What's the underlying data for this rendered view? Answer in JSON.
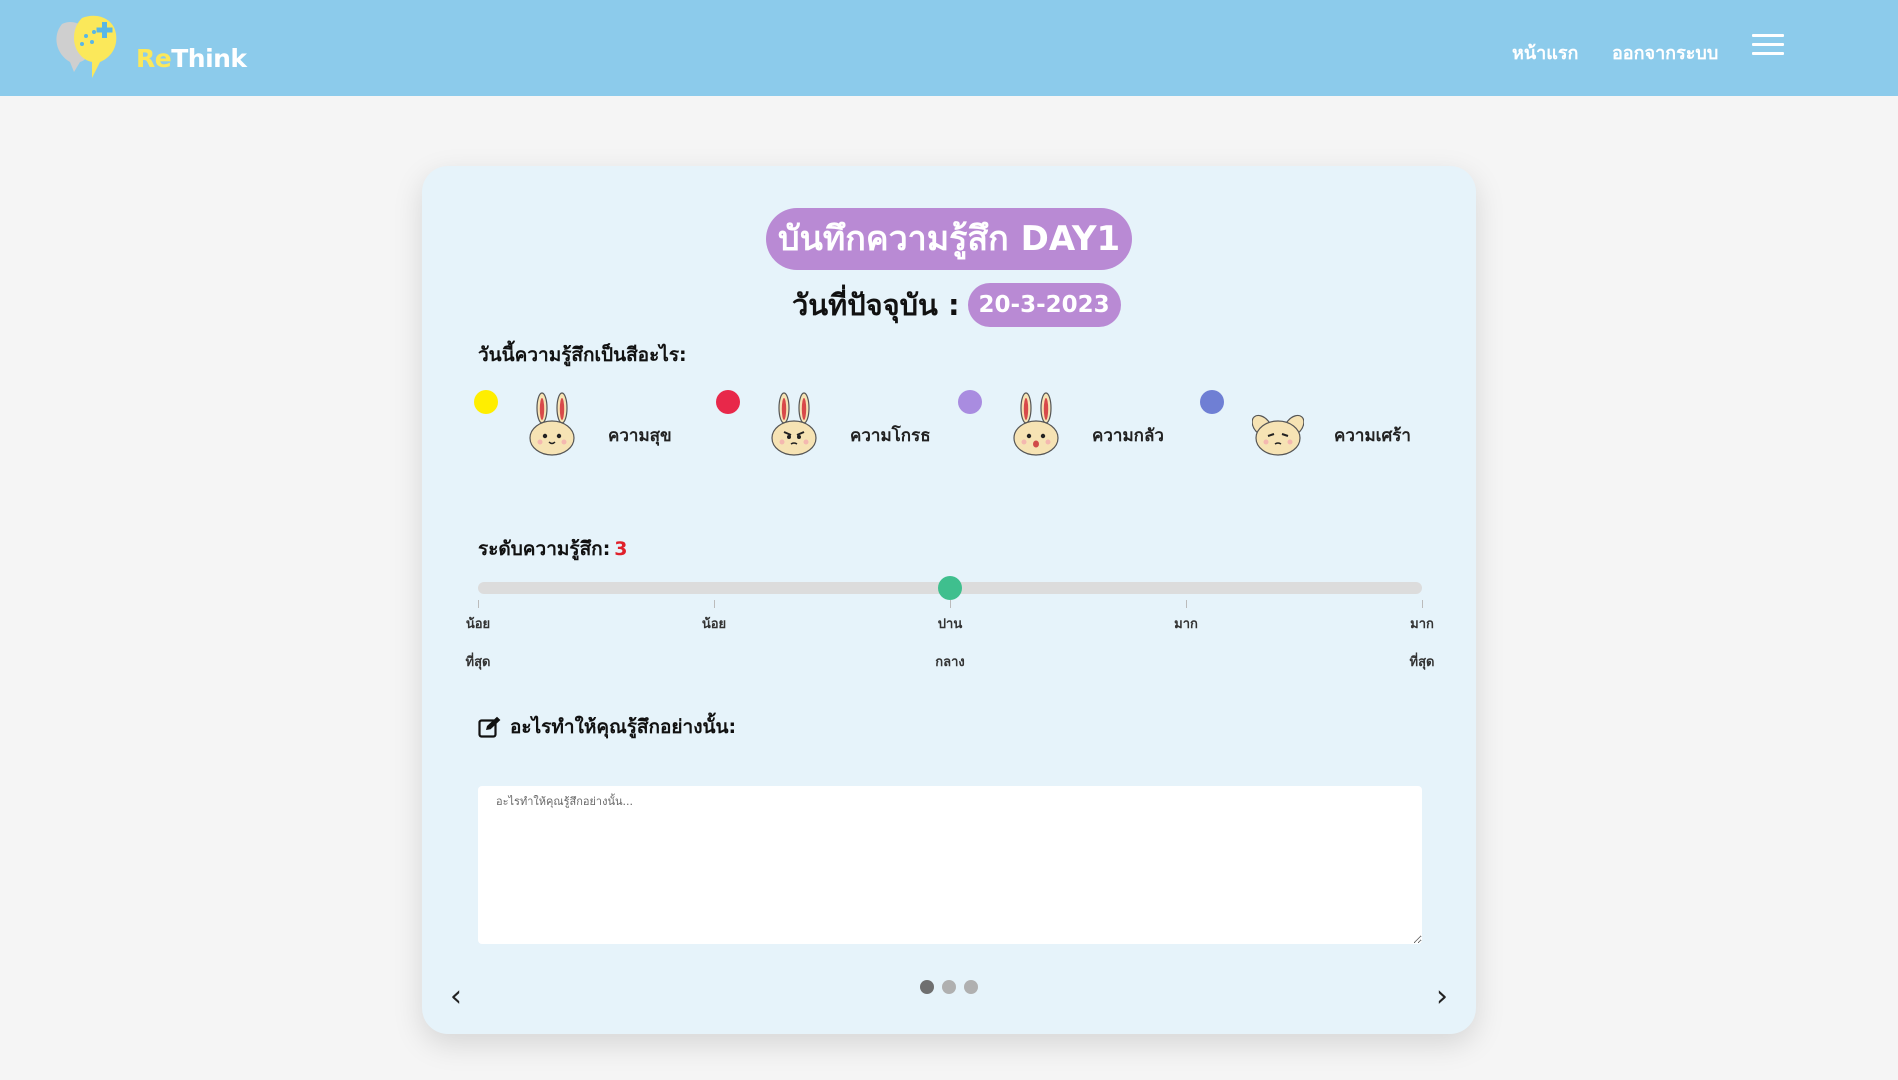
{
  "navbar": {
    "logo_re": "Re",
    "logo_think": "Think",
    "home_label": "หน้าแรก",
    "logout_label": "ออกจากระบบ",
    "menu_icon": "hamburger-icon"
  },
  "card": {
    "title": "บันทึกความรู้สึก DAY1",
    "date_label": "วันที่ปัจจุบัน :",
    "date_value": "20-3-2023",
    "question": "วันนี้ความรู้สึกเป็นสีอะไร:",
    "emotions": [
      {
        "label": "ความสุข",
        "color": "#ffee00",
        "icon": "happy-bunny-icon"
      },
      {
        "label": "ความโกรธ",
        "color": "#e8284a",
        "icon": "angry-bunny-icon"
      },
      {
        "label": "ความกลัว",
        "color": "#a98ce0",
        "icon": "scared-bunny-icon"
      },
      {
        "label": "ความเศร้า",
        "color": "#6f7fd4",
        "icon": "sad-bunny-icon"
      }
    ],
    "level_label": "ระดับความรู้สึก:",
    "level_value": "3",
    "slider": {
      "min": 1,
      "max": 5,
      "value": 3
    },
    "scale_labels": [
      {
        "line1": "น้อย",
        "line2": "ที่สุด"
      },
      {
        "line1": "น้อย",
        "line2": ""
      },
      {
        "line1": "ปาน",
        "line2": "กลาง"
      },
      {
        "line1": "มาก",
        "line2": ""
      },
      {
        "line1": "มาก",
        "line2": "ที่สุด"
      }
    ],
    "reason_label": "อะไรทำให้คุณรู้สึกอย่างนั้น:",
    "reason_placeholder": "อะไรทำให้คุณรู้สึกอย่างนั้น...",
    "reason_value": "",
    "prev_label": "‹",
    "next_label": "›",
    "pagination": {
      "total": 3,
      "current": 1
    }
  },
  "colors": {
    "navbar": "#8ccbeb",
    "card": "#e6f3fa",
    "pill": "#b98ad4",
    "slider_thumb": "#3fbf8e",
    "level_value": "#e0202a"
  }
}
